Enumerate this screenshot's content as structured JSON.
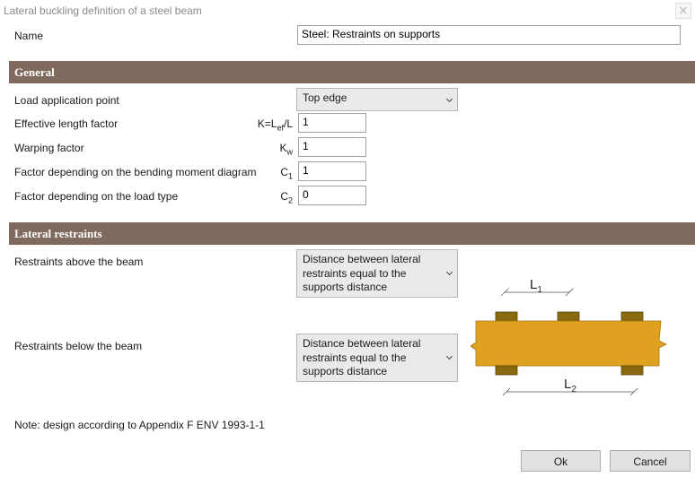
{
  "window": {
    "title": "Lateral buckling definition of a steel beam"
  },
  "name_row": {
    "label": "Name",
    "value": "Steel: Restraints on supports"
  },
  "general": {
    "header": "General",
    "load_point": {
      "label": "Load application point",
      "value": "Top edge"
    },
    "effective_length": {
      "label": "Effective length factor",
      "symbol": "K=Lef/L",
      "value": "1"
    },
    "warping": {
      "label": "Warping factor",
      "symbol": "Kw",
      "value": "1"
    },
    "bending_factor": {
      "label": "Factor depending on the bending moment diagram",
      "symbol": "C1",
      "value": "1"
    },
    "load_type_factor": {
      "label": "Factor depending on the load type",
      "symbol": "C2",
      "value": "0"
    }
  },
  "lateral": {
    "header": "Lateral restraints",
    "above": {
      "label": "Restraints above the beam",
      "value": "Distance between lateral\nrestraints equal to the\nsupports distance"
    },
    "below": {
      "label": "Restraints below the beam",
      "value": "Distance between lateral\nrestraints equal to the\nsupports distance"
    }
  },
  "diagram": {
    "l1_label": "L1",
    "l2_label": "L2",
    "beam_color": "#e0a020",
    "restraint_color": "#8a6a10"
  },
  "note": "Note: design according to Appendix F ENV 1993-1-1",
  "buttons": {
    "ok": "Ok",
    "cancel": "Cancel"
  },
  "colors": {
    "section_header": "#7f6a5d"
  }
}
